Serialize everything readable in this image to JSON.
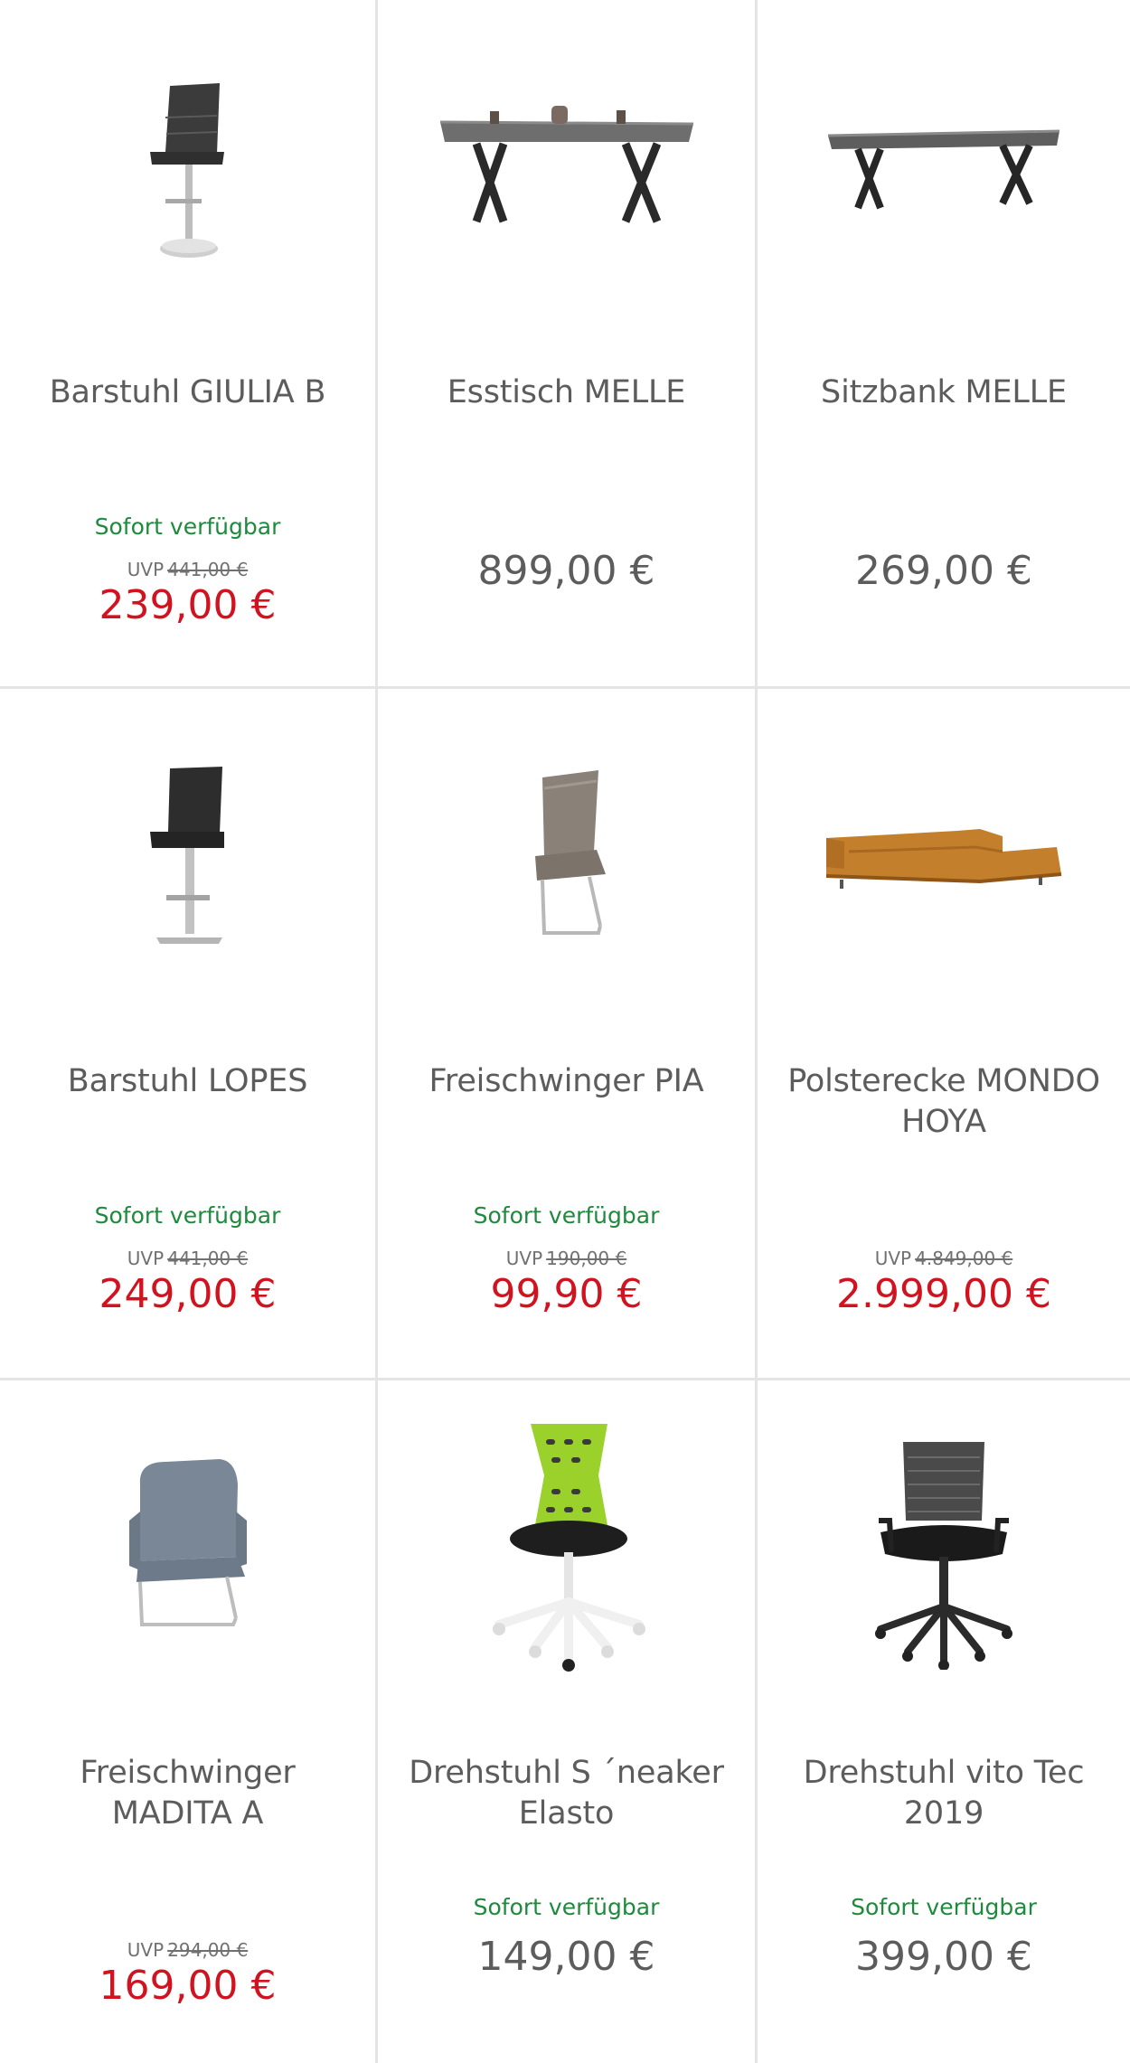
{
  "products": [
    {
      "name": "Barstuhl GIULIA B",
      "availability": "Sofort verfügbar",
      "uvp_label": "UVP",
      "uvp_price": "441,00 €",
      "price": "239,00 €",
      "image_icon": "bar-stool-giulia-icon"
    },
    {
      "name": "Esstisch MELLE",
      "availability": "",
      "uvp_label": "",
      "uvp_price": "",
      "price": "899,00 €",
      "image_icon": "dining-table-icon"
    },
    {
      "name": "Sitzbank MELLE",
      "availability": "",
      "uvp_label": "",
      "uvp_price": "",
      "price": "269,00 €",
      "image_icon": "bench-icon"
    },
    {
      "name": "Barstuhl LOPES",
      "availability": "Sofort verfügbar",
      "uvp_label": "UVP",
      "uvp_price": "441,00 €",
      "price": "249,00 €",
      "image_icon": "bar-stool-lopes-icon"
    },
    {
      "name": "Freischwinger PIA",
      "availability": "Sofort verfügbar",
      "uvp_label": "UVP",
      "uvp_price": "190,00 €",
      "price": "99,90 €",
      "image_icon": "cantilever-chair-icon"
    },
    {
      "name": "Polsterecke MONDO HOYA",
      "availability": "",
      "uvp_label": "UVP",
      "uvp_price": "4.849,00 €",
      "price": "2.999,00 €",
      "image_icon": "corner-sofa-icon"
    },
    {
      "name": "Freischwinger MADITA A",
      "availability": "",
      "uvp_label": "UVP",
      "uvp_price": "294,00 €",
      "price": "169,00 €",
      "image_icon": "armchair-icon"
    },
    {
      "name": "Drehstuhl S ´neaker Elasto",
      "availability": "Sofort verfügbar",
      "uvp_label": "",
      "uvp_price": "",
      "price": "149,00 €",
      "image_icon": "swivel-chair-green-icon"
    },
    {
      "name": "Drehstuhl vito Tec 2019",
      "availability": "Sofort verfügbar",
      "uvp_label": "",
      "uvp_price": "",
      "price": "399,00 €",
      "image_icon": "office-chair-icon"
    }
  ],
  "colors": {
    "availability": "#1e8a3c",
    "sale_price": "#d0131f",
    "regular_price": "#5c5c5c",
    "divider": "#e4e4e4"
  }
}
